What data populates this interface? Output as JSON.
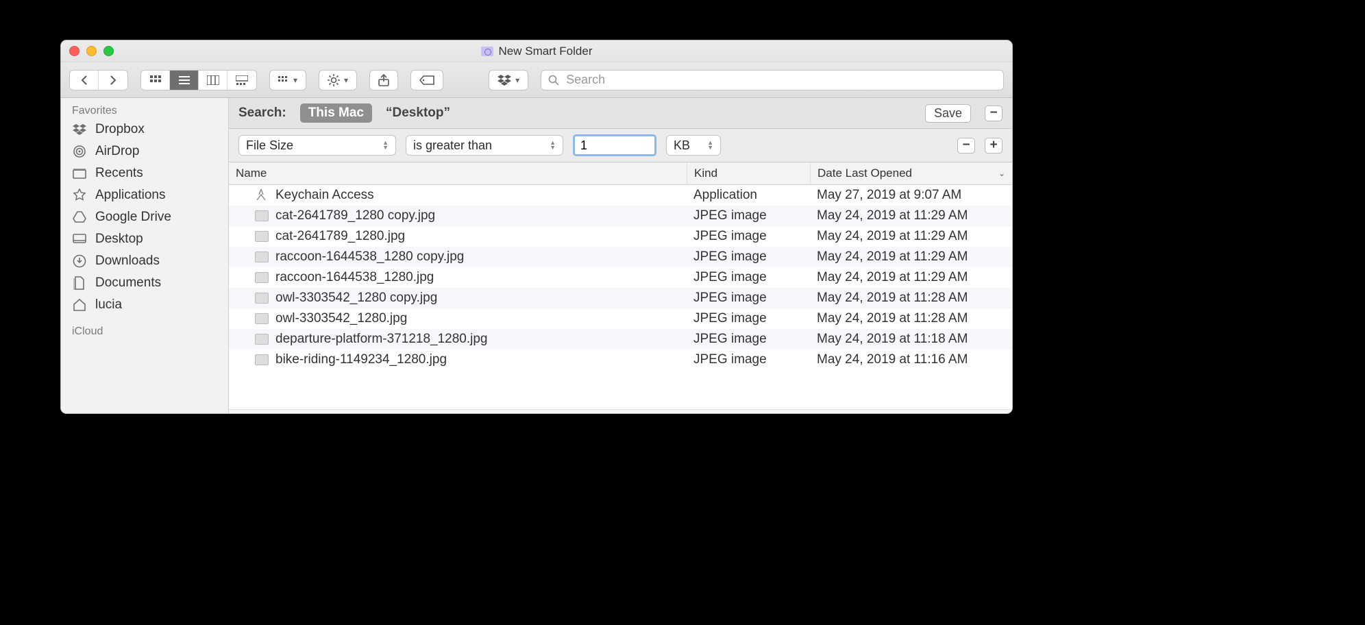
{
  "window": {
    "title": "New Smart Folder"
  },
  "toolbar": {
    "search_placeholder": "Search"
  },
  "sidebar": {
    "sections": [
      {
        "label": "Favorites"
      },
      {
        "label": "iCloud"
      }
    ],
    "items": [
      {
        "icon": "dropbox",
        "label": "Dropbox"
      },
      {
        "icon": "airdrop",
        "label": "AirDrop"
      },
      {
        "icon": "recents",
        "label": "Recents"
      },
      {
        "icon": "apps",
        "label": "Applications"
      },
      {
        "icon": "gdrive",
        "label": "Google Drive"
      },
      {
        "icon": "desktop",
        "label": "Desktop"
      },
      {
        "icon": "downloads",
        "label": "Downloads"
      },
      {
        "icon": "documents",
        "label": "Documents"
      },
      {
        "icon": "home",
        "label": "lucia"
      }
    ]
  },
  "searchbar": {
    "label": "Search:",
    "scope_active": "This Mac",
    "scope_other": "“Desktop”",
    "save": "Save"
  },
  "criteria": {
    "attribute": "File Size",
    "operator": "is greater than",
    "value": "1",
    "unit": "KB"
  },
  "columns": {
    "name": "Name",
    "kind": "Kind",
    "date": "Date Last Opened"
  },
  "rows": [
    {
      "icon": "app",
      "name": "Keychain Access",
      "kind": "Application",
      "date": "May 27, 2019 at 9:07 AM"
    },
    {
      "icon": "jpg",
      "name": "cat-2641789_1280 copy.jpg",
      "kind": "JPEG image",
      "date": "May 24, 2019 at 11:29 AM"
    },
    {
      "icon": "jpg",
      "name": "cat-2641789_1280.jpg",
      "kind": "JPEG image",
      "date": "May 24, 2019 at 11:29 AM"
    },
    {
      "icon": "jpg",
      "name": "raccoon-1644538_1280 copy.jpg",
      "kind": "JPEG image",
      "date": "May 24, 2019 at 11:29 AM"
    },
    {
      "icon": "jpg",
      "name": "raccoon-1644538_1280.jpg",
      "kind": "JPEG image",
      "date": "May 24, 2019 at 11:29 AM"
    },
    {
      "icon": "jpg",
      "name": "owl-3303542_1280 copy.jpg",
      "kind": "JPEG image",
      "date": "May 24, 2019 at 11:28 AM"
    },
    {
      "icon": "jpg",
      "name": "owl-3303542_1280.jpg",
      "kind": "JPEG image",
      "date": "May 24, 2019 at 11:28 AM"
    },
    {
      "icon": "jpg",
      "name": "departure-platform-371218_1280.jpg",
      "kind": "JPEG image",
      "date": "May 24, 2019 at 11:18 AM"
    },
    {
      "icon": "jpg",
      "name": "bike-riding-1149234_1280.jpg",
      "kind": "JPEG image",
      "date": "May 24, 2019 at 11:16 AM"
    }
  ]
}
